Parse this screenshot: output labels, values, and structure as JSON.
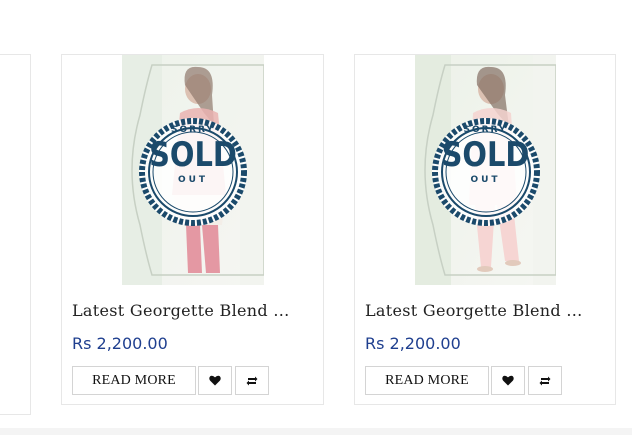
{
  "products": [
    {
      "title": "Latest Georgette Blend ...",
      "price": "Rs 2,200.00",
      "badge": {
        "top": "SORRY",
        "main": "SOLD",
        "bottom": "OUT"
      },
      "read_more": "READ MORE",
      "wishlist_icon": "heart-icon",
      "compare_icon": "refresh-icon"
    },
    {
      "title": "Latest Georgette Blend ...",
      "price": "Rs 2,200.00",
      "badge": {
        "top": "SORRY",
        "main": "SOLD",
        "bottom": "OUT"
      },
      "read_more": "READ MORE",
      "wishlist_icon": "heart-icon",
      "compare_icon": "refresh-icon"
    }
  ],
  "partial_card": {
    "title_tail": "..."
  },
  "colors": {
    "price": "#1f3f8f",
    "badge": "#1b4a6b",
    "border": "#e7e7e7"
  }
}
